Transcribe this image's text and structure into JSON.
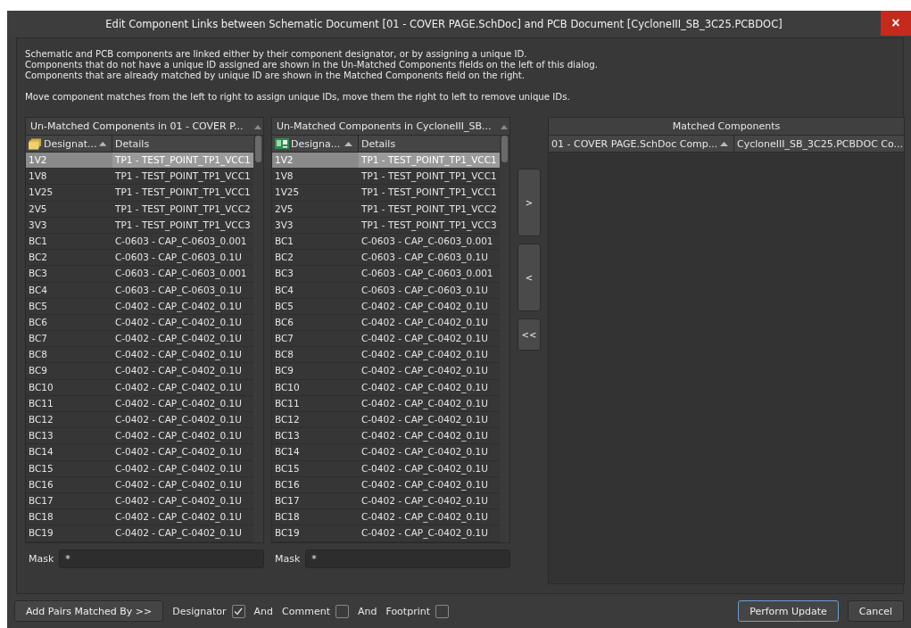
{
  "window": {
    "title": "Edit Component Links between Schematic Document [01 - COVER PAGE.SchDoc] and PCB Document [CycloneIII_SB_3C25.PCBDOC]",
    "close": "×"
  },
  "description": [
    "Schematic and PCB components are linked either by their component designator, or by assigning a unique ID.",
    "Components that do not have a unique ID assigned are shown in the Un-Matched Components fields on the left of this dialog.",
    "Components that are already matched by unique ID are shown in the Matched Components field on the right.",
    "Move component matches from the left to right to assign unique IDs, move them the right to left to remove unique IDs."
  ],
  "unmatched_lists": [
    {
      "title": "Un-Matched Components in 01 - COVER P...",
      "columns": [
        "Designat...",
        "Details"
      ],
      "mask": {
        "label": "Mask",
        "value": "*"
      },
      "rows": [
        {
          "designator": "1V2",
          "details": "TP1 - TEST_POINT_TP1_VCC1",
          "selected": true
        },
        {
          "designator": "1V8",
          "details": "TP1 - TEST_POINT_TP1_VCC1",
          "selected": false
        },
        {
          "designator": "1V25",
          "details": "TP1 - TEST_POINT_TP1_VCC1",
          "selected": false
        },
        {
          "designator": "2V5",
          "details": "TP1 - TEST_POINT_TP1_VCC2",
          "selected": false
        },
        {
          "designator": "3V3",
          "details": "TP1 - TEST_POINT_TP1_VCC3",
          "selected": false
        },
        {
          "designator": "BC1",
          "details": "C-0603 - CAP_C-0603_0.001",
          "selected": false
        },
        {
          "designator": "BC2",
          "details": "C-0603 - CAP_C-0603_0.1U",
          "selected": false
        },
        {
          "designator": "BC3",
          "details": "C-0603 - CAP_C-0603_0.001",
          "selected": false
        },
        {
          "designator": "BC4",
          "details": "C-0603 - CAP_C-0603_0.1U",
          "selected": false
        },
        {
          "designator": "BC5",
          "details": "C-0402 - CAP_C-0402_0.1U",
          "selected": false
        },
        {
          "designator": "BC6",
          "details": "C-0402 - CAP_C-0402_0.1U",
          "selected": false
        },
        {
          "designator": "BC7",
          "details": "C-0402 - CAP_C-0402_0.1U",
          "selected": false
        },
        {
          "designator": "BC8",
          "details": "C-0402 - CAP_C-0402_0.1U",
          "selected": false
        },
        {
          "designator": "BC9",
          "details": "C-0402 - CAP_C-0402_0.1U",
          "selected": false
        },
        {
          "designator": "BC10",
          "details": "C-0402 - CAP_C-0402_0.1U",
          "selected": false
        },
        {
          "designator": "BC11",
          "details": "C-0402 - CAP_C-0402_0.1U",
          "selected": false
        },
        {
          "designator": "BC12",
          "details": "C-0402 - CAP_C-0402_0.1U",
          "selected": false
        },
        {
          "designator": "BC13",
          "details": "C-0402 - CAP_C-0402_0.1U",
          "selected": false
        },
        {
          "designator": "BC14",
          "details": "C-0402 - CAP_C-0402_0.1U",
          "selected": false
        },
        {
          "designator": "BC15",
          "details": "C-0402 - CAP_C-0402_0.1U",
          "selected": false
        },
        {
          "designator": "BC16",
          "details": "C-0402 - CAP_C-0402_0.1U",
          "selected": false
        },
        {
          "designator": "BC17",
          "details": "C-0402 - CAP_C-0402_0.1U",
          "selected": false
        },
        {
          "designator": "BC18",
          "details": "C-0402 - CAP_C-0402_0.1U",
          "selected": false
        },
        {
          "designator": "BC19",
          "details": "C-0402 - CAP_C-0402_0.1U",
          "selected": false
        }
      ]
    },
    {
      "title": "Un-Matched Components in CycloneIII_SB...",
      "columns": [
        "Designa...",
        "Details"
      ],
      "mask": {
        "label": "Mask",
        "value": "*"
      },
      "rows": [
        {
          "designator": "1V2",
          "details": "TP1 - TEST_POINT_TP1_VCC1",
          "selected": true
        },
        {
          "designator": "1V8",
          "details": "TP1 - TEST_POINT_TP1_VCC1",
          "selected": false
        },
        {
          "designator": "1V25",
          "details": "TP1 - TEST_POINT_TP1_VCC1",
          "selected": false
        },
        {
          "designator": "2V5",
          "details": "TP1 - TEST_POINT_TP1_VCC2",
          "selected": false
        },
        {
          "designator": "3V3",
          "details": "TP1 - TEST_POINT_TP1_VCC3",
          "selected": false
        },
        {
          "designator": "BC1",
          "details": "C-0603 - CAP_C-0603_0.001",
          "selected": false
        },
        {
          "designator": "BC2",
          "details": "C-0603 - CAP_C-0603_0.1U",
          "selected": false
        },
        {
          "designator": "BC3",
          "details": "C-0603 - CAP_C-0603_0.001",
          "selected": false
        },
        {
          "designator": "BC4",
          "details": "C-0603 - CAP_C-0603_0.1U",
          "selected": false
        },
        {
          "designator": "BC5",
          "details": "C-0402 - CAP_C-0402_0.1U",
          "selected": false
        },
        {
          "designator": "BC6",
          "details": "C-0402 - CAP_C-0402_0.1U",
          "selected": false
        },
        {
          "designator": "BC7",
          "details": "C-0402 - CAP_C-0402_0.1U",
          "selected": false
        },
        {
          "designator": "BC8",
          "details": "C-0402 - CAP_C-0402_0.1U",
          "selected": false
        },
        {
          "designator": "BC9",
          "details": "C-0402 - CAP_C-0402_0.1U",
          "selected": false
        },
        {
          "designator": "BC10",
          "details": "C-0402 - CAP_C-0402_0.1U",
          "selected": false
        },
        {
          "designator": "BC11",
          "details": "C-0402 - CAP_C-0402_0.1U",
          "selected": false
        },
        {
          "designator": "BC12",
          "details": "C-0402 - CAP_C-0402_0.1U",
          "selected": false
        },
        {
          "designator": "BC13",
          "details": "C-0402 - CAP_C-0402_0.1U",
          "selected": false
        },
        {
          "designator": "BC14",
          "details": "C-0402 - CAP_C-0402_0.1U",
          "selected": false
        },
        {
          "designator": "BC15",
          "details": "C-0402 - CAP_C-0402_0.1U",
          "selected": false
        },
        {
          "designator": "BC16",
          "details": "C-0402 - CAP_C-0402_0.1U",
          "selected": false
        },
        {
          "designator": "BC17",
          "details": "C-0402 - CAP_C-0402_0.1U",
          "selected": false
        },
        {
          "designator": "BC18",
          "details": "C-0402 - CAP_C-0402_0.1U",
          "selected": false
        },
        {
          "designator": "BC19",
          "details": "C-0402 - CAP_C-0402_0.1U",
          "selected": false
        }
      ]
    }
  ],
  "move_buttons": [
    ">",
    "<",
    "<<"
  ],
  "matched": {
    "title": "Matched Components",
    "columns": [
      "01 - COVER PAGE.SchDoc Comp...",
      "CycloneIII_SB_3C25.PCBDOC Co..."
    ]
  },
  "footer": {
    "add_pairs": "Add Pairs Matched By >>",
    "criteria": [
      {
        "label": "Designator",
        "checked": true
      },
      {
        "joiner": "And",
        "label": "Comment",
        "checked": false
      },
      {
        "joiner": "And",
        "label": "Footprint",
        "checked": false
      }
    ],
    "buttons": [
      {
        "label": "Perform Update",
        "focused": true
      },
      {
        "label": "Cancel",
        "focused": false
      }
    ]
  }
}
